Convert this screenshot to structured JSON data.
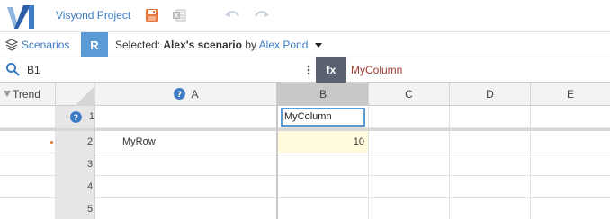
{
  "app": {
    "project_title": "Visyond Project",
    "icons": [
      "save-icon",
      "excel-export-icon",
      "undo-icon",
      "redo-icon"
    ]
  },
  "scenario_bar": {
    "scenarios_label": "Scenarios",
    "badge": "R",
    "selected_prefix": "Selected:",
    "scenario_name": "Alex's scenario",
    "by": "by",
    "owner": "Alex Pond"
  },
  "formula_bar": {
    "cell_ref": "B1",
    "fx_label": "fx",
    "formula": "MyColumn"
  },
  "grid": {
    "trend_header": "Trend",
    "columns": [
      "A",
      "B",
      "C",
      "D",
      "E"
    ],
    "selected_column": "B",
    "rows": [
      {
        "num": "1",
        "a": "",
        "b": "MyColumn"
      },
      {
        "num": "2",
        "a": "MyRow",
        "b": "10"
      },
      {
        "num": "3",
        "a": "",
        "b": ""
      },
      {
        "num": "4",
        "a": "",
        "b": ""
      },
      {
        "num": "5",
        "a": "",
        "b": ""
      }
    ]
  },
  "colors": {
    "accent": "#3d7cc4",
    "badge": "#5b9bd5",
    "fx_bg": "#5a6170",
    "formula_text": "#a13b2f",
    "value_cell_bg": "#fffbdc",
    "selected_border": "#5b9bd5",
    "save_icon": "#e8763a"
  }
}
